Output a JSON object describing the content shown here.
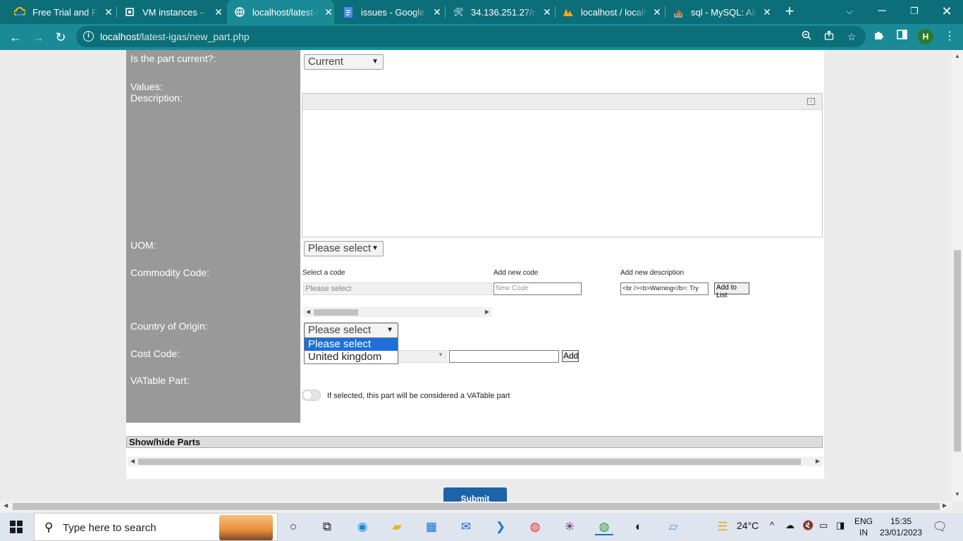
{
  "browser": {
    "tabs": [
      {
        "title": "Free Trial and Free",
        "icon": "google-cloud-icon",
        "active": false
      },
      {
        "title": "VM instances – Co",
        "icon": "compute-icon",
        "active": false
      },
      {
        "title": "localhost/latest-ig",
        "icon": "globe-icon",
        "active": true
      },
      {
        "title": "issues - Google Do",
        "icon": "docs-icon",
        "active": false
      },
      {
        "title": "34.136.251.27/ne",
        "icon": "tools-icon",
        "active": false
      },
      {
        "title": "localhost / localh",
        "icon": "phpmyadmin-icon",
        "active": false
      },
      {
        "title": "sql - MySQL: All p",
        "icon": "stackoverflow-icon",
        "active": false
      }
    ],
    "url_host": "localhost",
    "url_path": "/latest-igas/new_part.php",
    "profile_initial": "H"
  },
  "form": {
    "current_label": "Is the part current?:",
    "current_value": "Current",
    "values_label": "Values:",
    "description_label": "Description:",
    "editor_toggle": "-",
    "uom_label": "UOM:",
    "uom_value": "Please select",
    "commodity_label": "Commodity Code:",
    "commodity_select_caption": "Select a code",
    "commodity_new_code_caption": "Add new code",
    "commodity_new_desc_caption": "Add new description",
    "commodity_select_value": "Please select",
    "commodity_new_code_placeholder": "New Code",
    "commodity_new_desc_value": "<br /><b>Warning</b>:  Try",
    "add_to_list_label": "Add to List",
    "country_label": "Country of Origin:",
    "country_value": "Please select",
    "country_options": [
      "Please select",
      "United kingdom"
    ],
    "cost_code_label": "Cost Code:",
    "cost_add_label": "Add",
    "vat_label": "VATable Part:",
    "vat_hint": "If selected, this part will be considered a VATable part",
    "show_hide_label": "Show/hide Parts",
    "submit_label": "Submit"
  },
  "taskbar": {
    "search_placeholder": "Type here to search",
    "weather": "24°C",
    "lang_top": "ENG",
    "lang_bottom": "IN",
    "time": "15:35",
    "date": "23/01/2023"
  }
}
